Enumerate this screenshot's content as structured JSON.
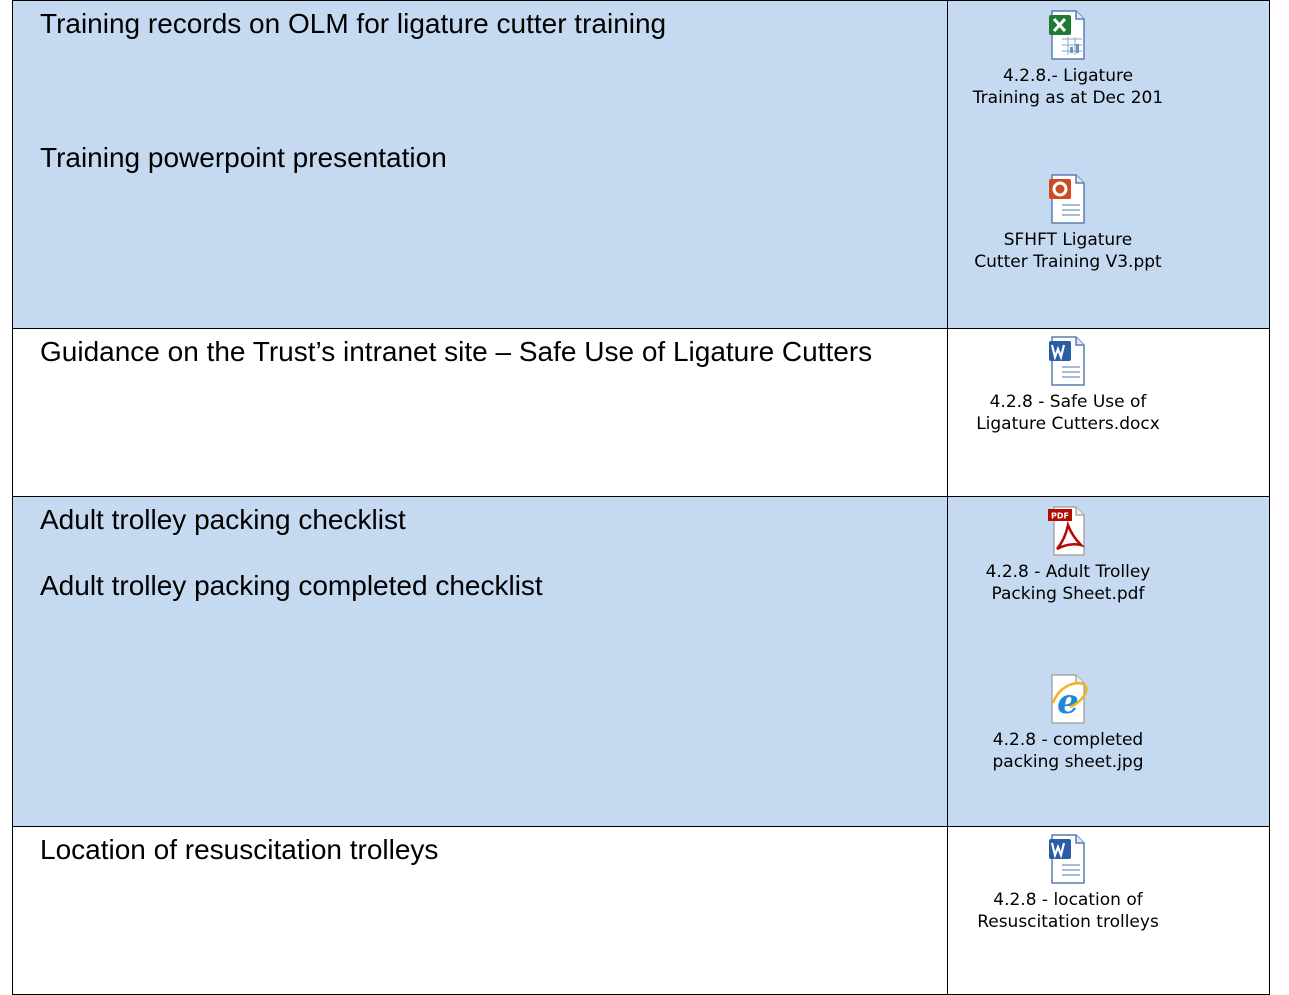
{
  "rows": [
    {
      "lines": [
        "Training records on OLM for ligature cutter training",
        "Training powerpoint presentation"
      ],
      "attachments": [
        {
          "icon": "excel-file-icon",
          "caption_1": "4.2.8.- Ligature",
          "caption_2": "Training as at Dec 201"
        },
        {
          "icon": "powerpoint-file-icon",
          "caption_1": "SFHFT Ligature",
          "caption_2": "Cutter Training V3.ppt"
        }
      ]
    },
    {
      "lines": [
        "Guidance on the Trust’s intranet site – Safe Use of Ligature Cutters"
      ],
      "attachments": [
        {
          "icon": "word-file-icon",
          "caption_1": "4.2.8 - Safe Use of",
          "caption_2": "Ligature Cutters.docx"
        }
      ]
    },
    {
      "lines": [
        "Adult trolley packing checklist",
        "Adult trolley packing completed checklist"
      ],
      "attachments": [
        {
          "icon": "pdf-file-icon",
          "pdf_label": "PDF",
          "caption_1": "4.2.8 - Adult Trolley",
          "caption_2": "Packing Sheet.pdf"
        },
        {
          "icon": "internet-explorer-icon",
          "caption_1": "4.2.8 - completed",
          "caption_2": "packing sheet.jpg"
        }
      ]
    },
    {
      "lines": [
        "Location of resuscitation trolleys"
      ],
      "attachments": [
        {
          "icon": "word-file-icon",
          "caption_1": "4.2.8 - location of",
          "caption_2": "Resuscitation trolleys"
        }
      ]
    }
  ],
  "colors": {
    "row_shaded": "#c5d9f1",
    "row_plain": "#ffffff",
    "border": "#000000"
  }
}
